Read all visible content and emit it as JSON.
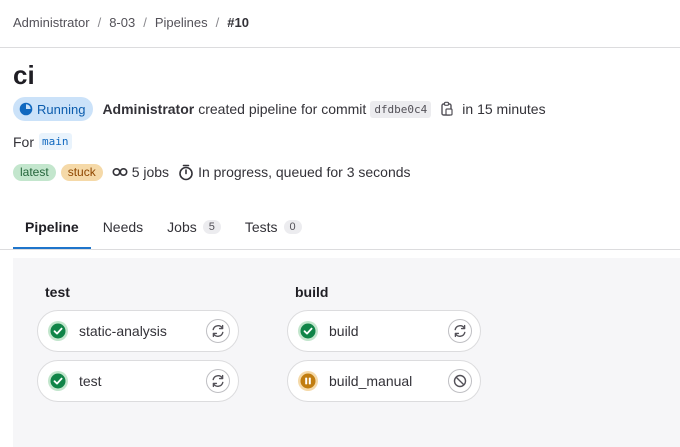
{
  "breadcrumb": {
    "items": [
      "Administrator",
      "8-03",
      "Pipelines"
    ],
    "current": "#10",
    "separator": "/"
  },
  "page": {
    "title": "ci"
  },
  "status": {
    "badge_label": "Running",
    "author": "Administrator",
    "created_text": "created pipeline for commit",
    "commit_sha": "dfdbe0c4",
    "time_text": "in 15 minutes"
  },
  "ref": {
    "prefix": "For",
    "branch": "main"
  },
  "meta": {
    "badges": {
      "latest": "latest",
      "stuck": "stuck"
    },
    "jobs_text": "5 jobs",
    "progress_text": "In progress, queued for 3 seconds"
  },
  "tabs": [
    {
      "label": "Pipeline",
      "count": null
    },
    {
      "label": "Needs",
      "count": null
    },
    {
      "label": "Jobs",
      "count": "5"
    },
    {
      "label": "Tests",
      "count": "0"
    }
  ],
  "stages": [
    {
      "name": "test",
      "jobs": [
        {
          "name": "static-analysis",
          "status": "success",
          "status_icon": "check-circle-icon",
          "action": "retry-icon"
        },
        {
          "name": "test",
          "status": "success",
          "status_icon": "check-circle-icon",
          "action": "retry-icon"
        }
      ]
    },
    {
      "name": "build",
      "jobs": [
        {
          "name": "build",
          "status": "success",
          "status_icon": "check-circle-icon",
          "action": "retry-icon"
        },
        {
          "name": "build_manual",
          "status": "manual",
          "status_icon": "pause-circle-icon",
          "action": "cancel-icon"
        }
      ]
    }
  ],
  "colors": {
    "running_bg": "#cbe2f9",
    "running_text": "#0b5cad",
    "success": "#108548",
    "manual": "#c17d10",
    "active_tab": "#1f75cb",
    "graph_bg": "#f6f6f8"
  }
}
